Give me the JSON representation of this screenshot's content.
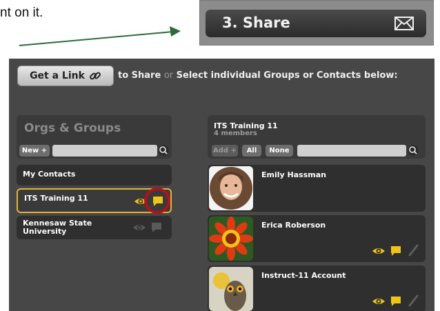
{
  "instruction": {
    "text": "nt on it."
  },
  "share_step": {
    "title": "3. Share",
    "icon": "envelope-icon"
  },
  "toolbar": {
    "get_link_label": "Get a Link",
    "share_text_1": "to Share",
    "or_text": "or",
    "share_text_2": "Select individual Groups or Contacts below:"
  },
  "orgs": {
    "title": "Orgs & Groups",
    "new_label": "New +",
    "search_placeholder": ""
  },
  "groups": [
    {
      "label": "My Contacts",
      "selected": false
    },
    {
      "label": "ITS Training 11",
      "selected": true
    },
    {
      "label": "Kennesaw State University",
      "selected": false
    }
  ],
  "team": {
    "name": "ITS Training 11",
    "members": "4 members",
    "add_label": "Add +",
    "all_label": "All",
    "none_label": "None"
  },
  "contacts": [
    {
      "name": "Emily Hassman"
    },
    {
      "name": "Erica Roberson"
    },
    {
      "name": "Instruct-11 Account"
    }
  ],
  "colors": {
    "arrow": "#2e6b3a",
    "highlight_circle": "#b5121b",
    "selected_border": "#e0b43c",
    "chat_yellow": "#f0c419",
    "panel_bg": "#474747"
  }
}
